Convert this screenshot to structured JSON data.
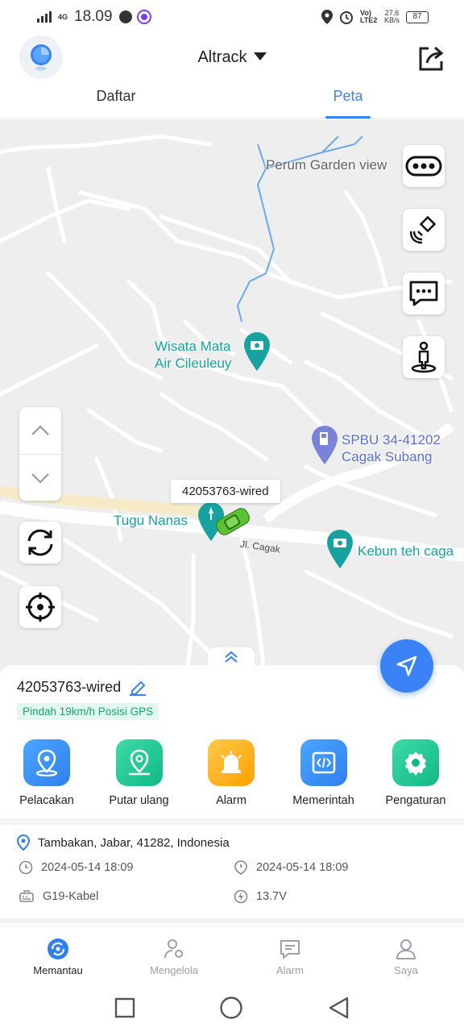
{
  "status_bar": {
    "time": "18.09",
    "net_label": "4G",
    "volte_label": "Vo) LTE2",
    "speed_value": "27,6",
    "speed_unit": "KB/s",
    "battery": "87"
  },
  "header": {
    "title": "Altrack",
    "logo_icon": "location-pie-icon",
    "share_icon": "share-icon"
  },
  "tabs": [
    {
      "label": "Daftar",
      "active": false
    },
    {
      "label": "Peta",
      "active": true
    }
  ],
  "map": {
    "places": {
      "perum": "Perum Garden view",
      "wisata_line1": "Wisata Mata",
      "wisata_line2": "Air Cileuleuy",
      "spbu_line1": "SPBU 34-41202",
      "spbu_line2": "Cagak Subang",
      "tugu": "Tugu Nanas",
      "kebun": "Kebun teh caga",
      "road": "Jl. Cagak"
    },
    "vehicle_label": "42053763-wired",
    "side_buttons": [
      "more-icon",
      "satellite-icon",
      "message-icon",
      "street-view-icon"
    ],
    "controls": [
      "zoom-up-icon",
      "zoom-down-icon",
      "refresh-icon",
      "locate-icon"
    ]
  },
  "device": {
    "name": "42053763-wired",
    "status": "Pindah 19km/h Posisi GPS",
    "actions": [
      {
        "label": "Pelacakan",
        "color": "#2f8ef5"
      },
      {
        "label": "Putar ulang",
        "color": "#20c997"
      },
      {
        "label": "Alarm",
        "color": "#ffb020"
      },
      {
        "label": "Memerintah",
        "color": "#2f8ef5"
      },
      {
        "label": "Pengaturan",
        "color": "#20c997"
      }
    ],
    "address": "Tambakan, Jabar, 41282, Indonesia",
    "time_gps": "2024-05-14 18:09",
    "time_location": "2024-05-14 18:09",
    "model": "G19-Kabel",
    "voltage": "13.7V"
  },
  "bottom_nav": [
    {
      "label": "Memantau",
      "active": true
    },
    {
      "label": "Mengelola",
      "active": false
    },
    {
      "label": "Alarm",
      "active": false
    },
    {
      "label": "Saya",
      "active": false
    }
  ],
  "colors": {
    "accent": "#3b82f6",
    "teal": "#17a2a0",
    "status_green": "#1aa273"
  }
}
